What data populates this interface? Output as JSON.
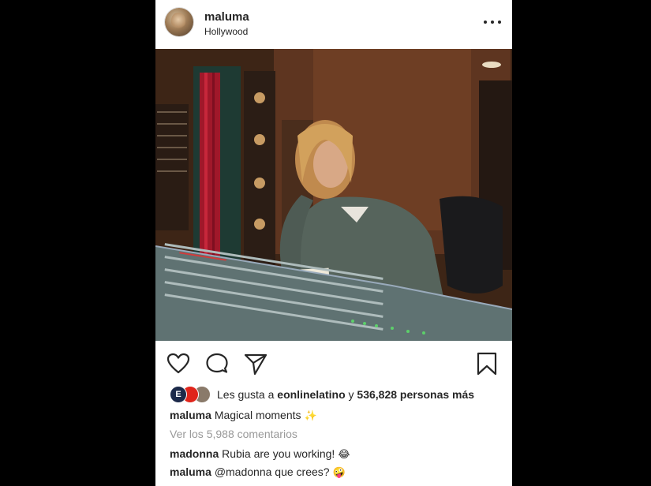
{
  "post": {
    "username": "maluma",
    "location": "Hollywood",
    "likes": {
      "prefix": "Les gusta a",
      "first_liker": "eonlinelatino",
      "connector": "y",
      "count": "536,828 personas más",
      "liker_badge": "E"
    },
    "caption": {
      "user": "maluma",
      "text": "Magical moments",
      "emoji": "✨"
    },
    "view_comments": "Ver los 5,988 comentarios",
    "comments": [
      {
        "user": "madonna",
        "text": "Rubia are you working!",
        "emoji": "😂"
      },
      {
        "user": "maluma",
        "mention": "@madonna",
        "text": "que crees?",
        "emoji": "🤪"
      }
    ]
  },
  "icons": {
    "more": "more-options-icon",
    "like": "heart-icon",
    "comment": "comment-icon",
    "share": "send-icon",
    "save": "bookmark-icon"
  },
  "colors": {
    "background": "#000000",
    "card": "#ffffff",
    "text": "#262626",
    "muted": "#999999",
    "eonline_red": "#e0251b"
  }
}
